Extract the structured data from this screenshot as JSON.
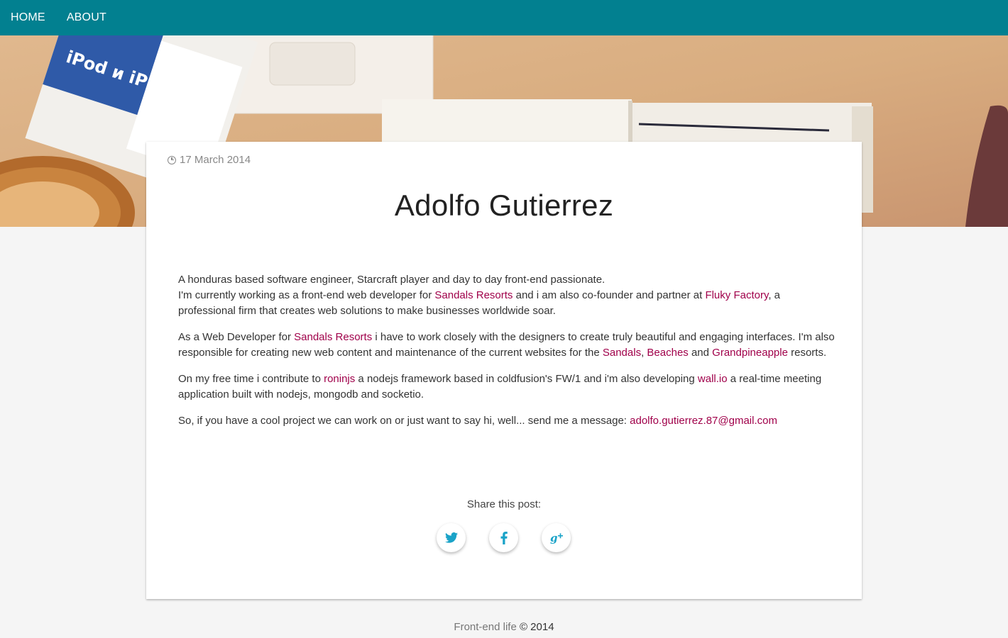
{
  "nav": {
    "items": [
      {
        "label": "HOME"
      },
      {
        "label": "ABOUT"
      }
    ]
  },
  "colors": {
    "navbar": "#028090",
    "link": "#a0004a",
    "share_icon": "#1aa3c8"
  },
  "post": {
    "date": "17 March 2014",
    "title": "Adolfo Gutierrez",
    "p1": {
      "line1": "A honduras based software engineer, Starcraft player and day to day front-end passionate.",
      "text_a": "I'm currently working as a front-end web developer for ",
      "link_sandals_resorts": "Sandals Resorts",
      "text_b": " and i am also co-founder and partner at ",
      "link_fluky": "Fluky Factory",
      "text_c": ", a professional firm that creates web solutions to make businesses worldwide soar."
    },
    "p2": {
      "text_a": "As a Web Developer for ",
      "link_sandals_resorts": "Sandals Resorts",
      "text_b": " i have to work closely with the designers to create truly beautiful and engaging interfaces. I'm also responsible for creating new web content and maintenance of the current websites for the ",
      "link_sandals": "Sandals",
      "sep1": ", ",
      "link_beaches": "Beaches",
      "sep2": " and ",
      "link_grandpineapple": "Grandpineapple",
      "text_c": " resorts."
    },
    "p3": {
      "text_a": "On my free time i contribute to ",
      "link_roninjs": "roninjs",
      "text_b": " a nodejs framework based in coldfusion's FW/1 and i'm also developing ",
      "link_wall": "wall.io",
      "text_c": " a real-time meeting application built with nodejs, mongodb and socketio."
    },
    "p4": {
      "text_a": "So, if you have a cool project we can work on or just want to say hi, well... send me a message: ",
      "link_email": "adolfo.gutierrez.87@gmail.com"
    }
  },
  "share": {
    "label": "Share this post:",
    "buttons": [
      {
        "icon": "twitter-icon",
        "glyph": "🐦"
      },
      {
        "icon": "facebook-icon",
        "glyph": "f"
      },
      {
        "icon": "google-plus-icon",
        "glyph": "g+"
      }
    ]
  },
  "footer": {
    "link": "Front-end life",
    "copyright": " © 2014"
  }
}
